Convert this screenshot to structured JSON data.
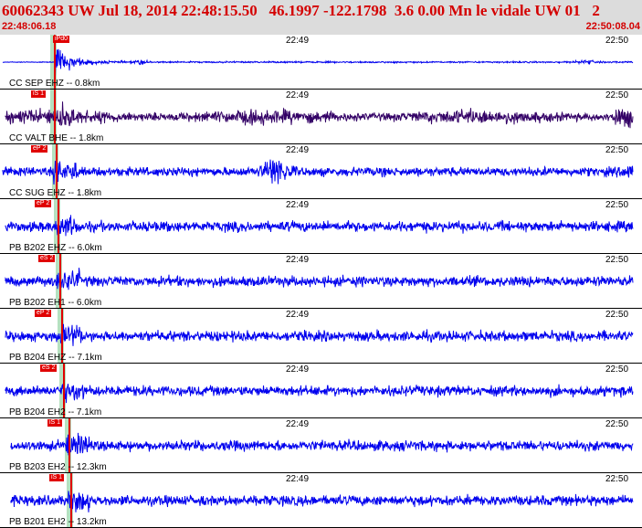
{
  "header": {
    "title": "60062343 UW Jul 18, 2014 22:48:15.50   46.1997 -122.1798  3.6 0.00 Mn le vidale UW 01   2",
    "start_time": "22:48:06.18",
    "end_time": "22:50:08.04"
  },
  "colors": {
    "header_bg": "#dcdcdc",
    "header_text": "#d40000",
    "trace_blue": "#0000ee",
    "trace_dark": "#330066",
    "pick_red": "#e00000",
    "arrival_green": "#78c88c"
  },
  "tick_labels": [
    "22:49",
    "22:50"
  ],
  "traces": [
    {
      "station": "CC SEP EHZ -- 0.8km",
      "pick": "iPd0",
      "type": "event",
      "color": "#0000ee"
    },
    {
      "station": "CC VALT BHE -- 1.8km",
      "pick": "iS 1",
      "type": "dense",
      "color": "#330066"
    },
    {
      "station": "CC SUG EHZ -- 1.8km",
      "pick": "eP 2",
      "type": "burst",
      "color": "#0000ee"
    },
    {
      "station": "PB B202 EHZ -- 6.0km",
      "pick": "eP 2",
      "type": "noise",
      "color": "#0000ee"
    },
    {
      "station": "PB B202 EH1 -- 6.0km",
      "pick": "eS 2",
      "type": "noise",
      "color": "#0000ee"
    },
    {
      "station": "PB B204 EHZ -- 7.1km",
      "pick": "eP 2",
      "type": "noise",
      "color": "#0000ee"
    },
    {
      "station": "PB B204 EH2 -- 7.1km",
      "pick": "eS 2",
      "type": "noise",
      "color": "#0000ee"
    },
    {
      "station": "PB B203 EH2 -- 12.3km",
      "pick": "iS 1",
      "type": "noise",
      "color": "#0000ee"
    },
    {
      "station": "PB B201 EH2 -- 13.2km",
      "pick": "iS 1",
      "type": "noise",
      "color": "#0000ee"
    }
  ]
}
